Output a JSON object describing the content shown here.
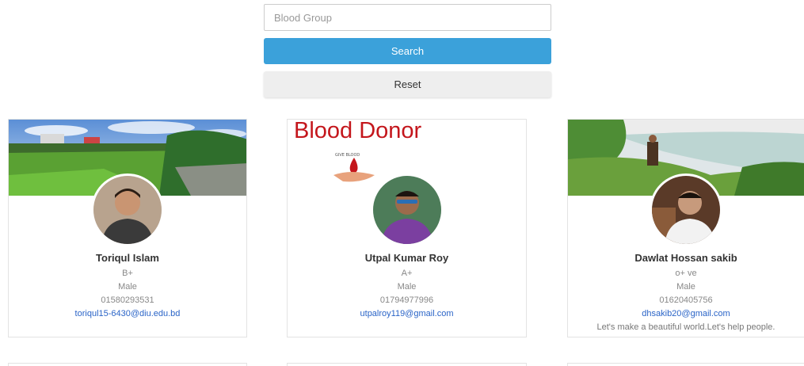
{
  "search": {
    "placeholder": "Blood Group",
    "value": "",
    "search_label": "Search",
    "reset_label": "Reset"
  },
  "donors": [
    {
      "name": "Toriqul Islam",
      "blood_group": "B+",
      "gender": "Male",
      "phone": "01580293531",
      "email": "toriqul15-6430@diu.edu.bd",
      "bio": ""
    },
    {
      "name": "Utpal Kumar Roy",
      "blood_group": "A+",
      "gender": "Male",
      "phone": "01794977996",
      "email": "utpalroy119@gmail.com",
      "bio": "",
      "cover_text": "Blood Donor",
      "cover_logo_text": "GIVE BLOOD"
    },
    {
      "name": "Dawlat Hossan sakib",
      "blood_group": "o+ ve",
      "gender": "Male",
      "phone": "01620405756",
      "email": "dhsakib20@gmail.com",
      "bio": "Let's make a beautiful world.Let's help people."
    }
  ],
  "colors": {
    "search_button": "#3ba1da",
    "reset_button": "#eeeeee",
    "email_link": "#2a64c7",
    "blood_red": "#c4161c"
  }
}
